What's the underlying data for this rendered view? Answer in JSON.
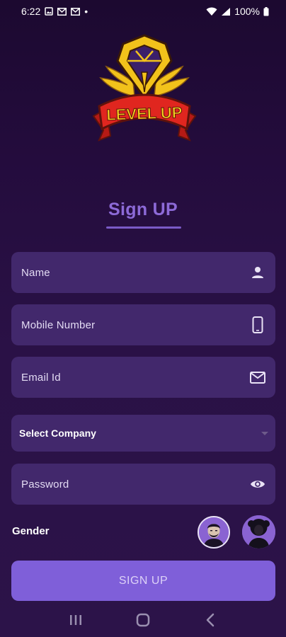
{
  "status_bar": {
    "time": "6:22",
    "battery": "100%",
    "dot": "•",
    "icons": [
      "gallery-icon",
      "mail-icon",
      "mail-icon",
      "wifi-icon",
      "signal-icon",
      "battery-icon"
    ]
  },
  "logo": {
    "text": "LEVEL UP",
    "colors": {
      "gold": "#f2c21b",
      "ribbon": "#e0261f",
      "outline": "#6b1a10"
    }
  },
  "page": {
    "title": "Sign UP"
  },
  "form": {
    "name": {
      "placeholder": "Name",
      "icon": "person-icon"
    },
    "mobile": {
      "placeholder": "Mobile Number",
      "icon": "phone-icon"
    },
    "email": {
      "placeholder": "Email Id",
      "icon": "mail-icon"
    },
    "company": {
      "selected": "Select Company",
      "icon": "caret-down-icon"
    },
    "password": {
      "placeholder": "Password",
      "icon": "eye-icon"
    },
    "gender": {
      "label": "Gender",
      "options": [
        {
          "value": "male",
          "icon": "male-avatar-icon",
          "selected": true
        },
        {
          "value": "female",
          "icon": "female-avatar-icon",
          "selected": false
        }
      ]
    },
    "submit_label": "SIGN UP"
  },
  "nav": {
    "icons": [
      "recent-apps-icon",
      "home-icon",
      "back-icon"
    ]
  },
  "colors": {
    "background": "#240c3d",
    "field": "#42286c",
    "accent": "#8d6ad8",
    "button": "#7f5fd9"
  }
}
